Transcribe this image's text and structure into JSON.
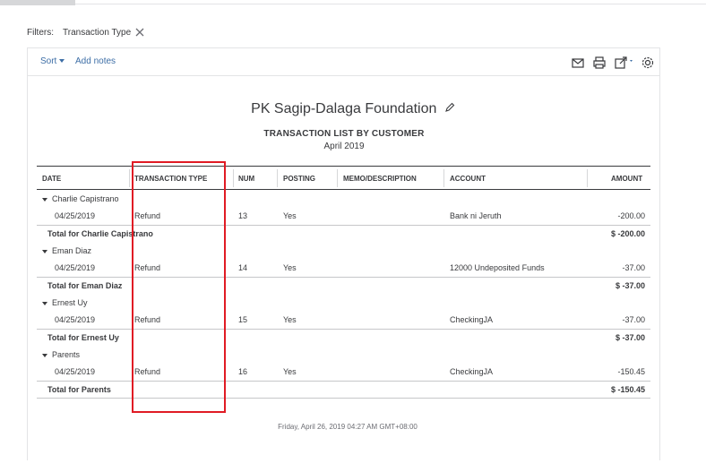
{
  "filters": {
    "label": "Filters:",
    "chip": "Transaction Type"
  },
  "toolbar": {
    "sort_label": "Sort",
    "add_notes_label": "Add notes"
  },
  "report": {
    "company": "PK Sagip-Dalaga Foundation",
    "title": "TRANSACTION LIST BY CUSTOMER",
    "date_range": "April 2019",
    "columns": [
      "DATE",
      "TRANSACTION TYPE",
      "NUM",
      "POSTING",
      "MEMO/DESCRIPTION",
      "ACCOUNT",
      "AMOUNT"
    ],
    "groups": [
      {
        "name": "Charlie Capistrano",
        "row": {
          "date": "04/25/2019",
          "type": "Refund",
          "num": "13",
          "posting": "Yes",
          "account": "Bank ni Jeruth",
          "amount": "-200.00"
        },
        "total_label": "Total for Charlie Capistrano",
        "total": "$ -200.00"
      },
      {
        "name": "Eman Diaz",
        "row": {
          "date": "04/25/2019",
          "type": "Refund",
          "num": "14",
          "posting": "Yes",
          "account": "12000 Undeposited Funds",
          "amount": "-37.00"
        },
        "total_label": "Total for Eman Diaz",
        "total": "$ -37.00"
      },
      {
        "name": "Ernest Uy",
        "row": {
          "date": "04/25/2019",
          "type": "Refund",
          "num": "15",
          "posting": "Yes",
          "account": "CheckingJA",
          "amount": "-37.00"
        },
        "total_label": "Total for Ernest Uy",
        "total": "$ -37.00"
      },
      {
        "name": "Parents",
        "row": {
          "date": "04/25/2019",
          "type": "Refund",
          "num": "16",
          "posting": "Yes",
          "account": "CheckingJA",
          "amount": "-150.45"
        },
        "total_label": "Total for Parents",
        "total": "$ -150.45"
      }
    ],
    "footer": "Friday, April 26, 2019   04:27 AM GMT+08:00"
  },
  "icons": {
    "close": "close-icon",
    "email": "email-icon",
    "print": "print-icon",
    "export": "export-icon",
    "settings": "gear-icon",
    "edit": "pencil-icon",
    "expand": "caret-down-icon"
  },
  "colors": {
    "link": "#3d6ea6",
    "highlight": "#e01b24",
    "text": "#393a3d"
  }
}
